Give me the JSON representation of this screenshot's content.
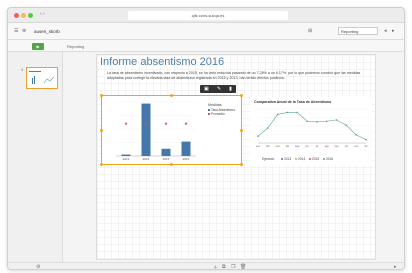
{
  "window": {
    "url": "qlik.cons.sucqa.es",
    "app_name": "ausen_stiorb"
  },
  "toolbar": {
    "dropdown_value": "Reporting"
  },
  "subbar": {
    "sheet_label": "Reporting",
    "play_label": "▶"
  },
  "left_panel": {
    "thumb_number": "1"
  },
  "sheet": {
    "title": "Informe absentismo 2016",
    "paragraph": "La tasa de absentismo incentivado, con respecto a 2015, se ha visto reducida pasando de un 7,28% a un 6,17%, por lo que podemos concluir que las medidas adoptadas para corregir la elevada tasa de absentismo registrada en 2015 y 2013, han tenido efectos positivos."
  },
  "bar_chart": {
    "legend_title": "Medidas",
    "legend_items": [
      "Tasa Absentismo",
      "Promedio"
    ],
    "colors": {
      "bar": "#4477aa",
      "avg": "#e05050"
    }
  },
  "line_chart": {
    "title": "Comparativa Anual de la Tasa de Absentismo",
    "legend_label": "Ejercicio",
    "legend_items": [
      "2013",
      "2014",
      "2015",
      "2016"
    ],
    "colors": {
      "line": "#5aa38c",
      "2013": "#4477aa",
      "2014": "#9acb6b",
      "2015": "#e05050"
    }
  },
  "chart_data": [
    {
      "type": "bar",
      "categories": [
        "2013",
        "2014",
        "2015",
        "2016"
      ],
      "series": [
        {
          "name": "Tasa Absentismo",
          "values": [
            0.2,
            7.28,
            1.0,
            2.0
          ]
        },
        {
          "name": "Promedio",
          "values": [
            4.5,
            4.5,
            4.5,
            4.5
          ]
        }
      ]
    },
    {
      "type": "line",
      "title": "Comparativa Anual de la Tasa de Absentismo",
      "categories": [
        "ene",
        "feb",
        "mar",
        "abr",
        "may",
        "jun",
        "jul",
        "ago",
        "sep",
        "oct",
        "nov",
        "dic"
      ],
      "series": [
        {
          "name": "2016",
          "values": [
            1.0,
            2.2,
            4.2,
            4.5,
            4.5,
            3.2,
            3.1,
            3.2,
            3.4,
            2.6,
            1.2,
            0.5
          ]
        }
      ]
    }
  ]
}
